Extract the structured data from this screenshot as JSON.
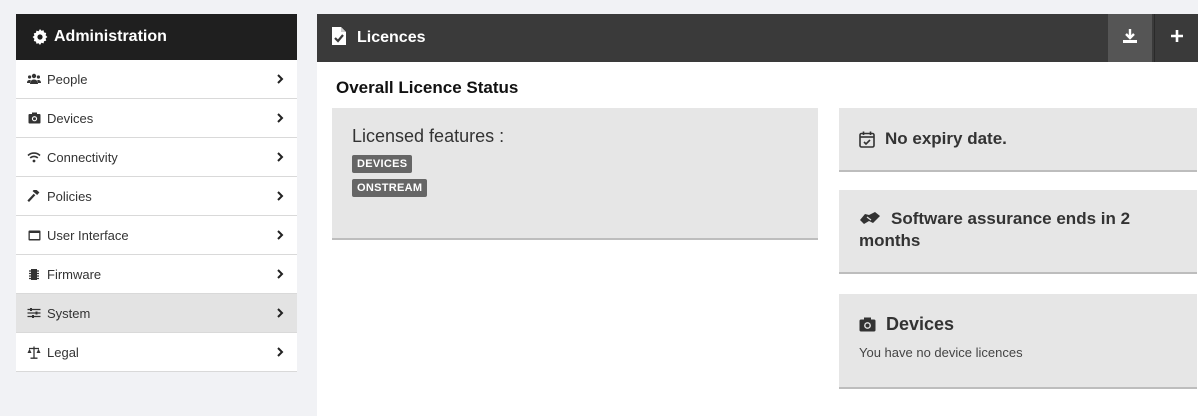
{
  "sidebar": {
    "title": "Administration",
    "items": [
      {
        "label": "People",
        "icon": "people-icon"
      },
      {
        "label": "Devices",
        "icon": "camera-icon"
      },
      {
        "label": "Connectivity",
        "icon": "wifi-icon"
      },
      {
        "label": "Policies",
        "icon": "gavel-icon"
      },
      {
        "label": "User Interface",
        "icon": "screen-icon"
      },
      {
        "label": "Firmware",
        "icon": "chip-icon"
      },
      {
        "label": "System",
        "icon": "sliders-icon",
        "active": true
      },
      {
        "label": "Legal",
        "icon": "scales-icon"
      }
    ]
  },
  "main": {
    "title": "Licences",
    "section_title": "Overall Licence Status",
    "features": {
      "title": "Licensed features :",
      "badges": [
        "DEVICES",
        "ONSTREAM"
      ]
    },
    "expiry": "No expiry date.",
    "assurance": "Software assurance ends in 2 months",
    "devices": {
      "title": "Devices",
      "text": "You have no device licences"
    }
  },
  "colors": {
    "sidebar_header": "#1f1f1f",
    "main_header": "#3a3a3a",
    "card_bg": "#e6e6e6",
    "badge_bg": "#666666",
    "active_item_bg": "#e3e3e3"
  }
}
